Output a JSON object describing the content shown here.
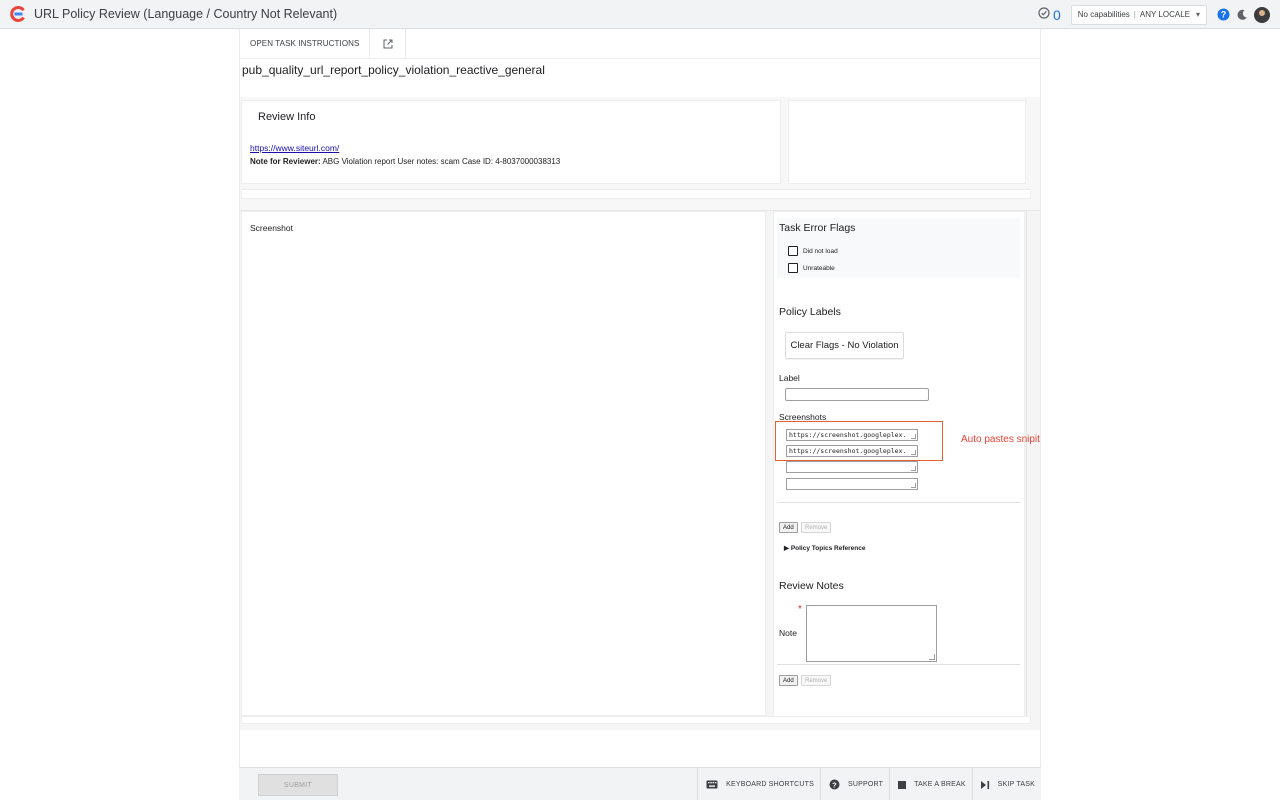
{
  "window": {
    "title": "URL Policy Review (Language / Country Not Relevant)"
  },
  "topbar": {
    "task_count": "0",
    "capabilities": "No capabilities",
    "locale": "ANY LOCALE",
    "icons": [
      "check-circle-icon",
      "help-icon",
      "dark-mode-icon",
      "avatar"
    ]
  },
  "toolbar": {
    "open_instructions": "OPEN TASK INSTRUCTIONS"
  },
  "task": {
    "name": "pub_quality_url_report_policy_violation_reactive_general"
  },
  "review_info": {
    "title": "Review Info",
    "url": "https://www.siteurl.com/",
    "note_label": "Note for Reviewer:",
    "note_text": " ABG Violation report User notes: scam Case ID: 4-8037000038313"
  },
  "screenshot_panel": {
    "label": "Screenshot"
  },
  "task_error_flags": {
    "title": "Task Error Flags",
    "options": [
      {
        "label": "Did not load",
        "checked": false
      },
      {
        "label": "Unrateable",
        "checked": false
      }
    ]
  },
  "policy_labels": {
    "title": "Policy Labels",
    "clear_button": "Clear Flags - No Violation",
    "label_field_label": "Label",
    "label_value": "",
    "screenshots_label": "Screenshots",
    "screenshots": [
      "https://screenshot.googleplex.",
      "https://screenshot.googleplex.",
      "",
      ""
    ],
    "add": "Add",
    "remove": "Remove",
    "topics_reference": "Policy Topics Reference"
  },
  "review_notes": {
    "title": "Review Notes",
    "required_mark": "*",
    "note_label": "Note",
    "note_value": "",
    "add": "Add",
    "remove": "Remove"
  },
  "annotation": {
    "text": "Auto pastes snipit",
    "color": "#ea4335"
  },
  "footer": {
    "submit": "SUBMIT",
    "keyboard_shortcuts": "KEYBOARD SHORTCUTS",
    "support": "SUPPORT",
    "take_break": "TAKE A BREAK",
    "skip_task": "SKIP TASK"
  },
  "colors": {
    "accent": "#1a73e8",
    "link": "#1a0dab",
    "highlight": "#e8602c",
    "logo_red": "#e8453c",
    "logo_blue": "#4285f4"
  }
}
